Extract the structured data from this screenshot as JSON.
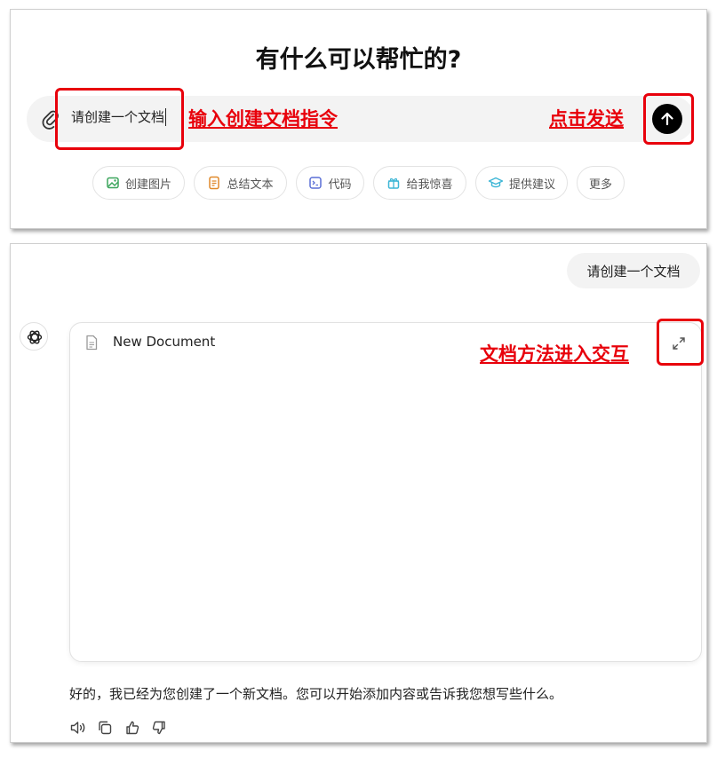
{
  "top": {
    "title": "有什么可以帮忙的?",
    "composer": {
      "value": "请创建一个文档"
    },
    "annotations": {
      "input_hint": "输入创建文档指令",
      "send_hint": "点击发送"
    },
    "chips": [
      {
        "label": "创建图片",
        "icon": "image-icon",
        "color": "#3ba55c"
      },
      {
        "label": "总结文本",
        "icon": "document-icon",
        "color": "#e0892b"
      },
      {
        "label": "代码",
        "icon": "terminal-icon",
        "color": "#5a6fd6"
      },
      {
        "label": "给我惊喜",
        "icon": "gift-icon",
        "color": "#3db6d6"
      },
      {
        "label": "提供建议",
        "icon": "graduation-cap-icon",
        "color": "#3db6d6"
      },
      {
        "label": "更多",
        "icon": "",
        "color": "#555555"
      }
    ]
  },
  "bottom": {
    "user_message": "请创建一个文档",
    "document": {
      "title": "New Document"
    },
    "annotation": "文档方法进入交互",
    "assistant_reply": "好的，我已经为您创建了一个新文档。您可以开始添加内容或告诉我您想写些什么。",
    "actions": [
      "speaker-icon",
      "copy-icon",
      "thumbs-up-icon",
      "thumbs-down-icon"
    ]
  },
  "colors": {
    "annotation_red": "#e8000b",
    "send_button": "#000000",
    "composer_bg": "#f3f3f3"
  }
}
